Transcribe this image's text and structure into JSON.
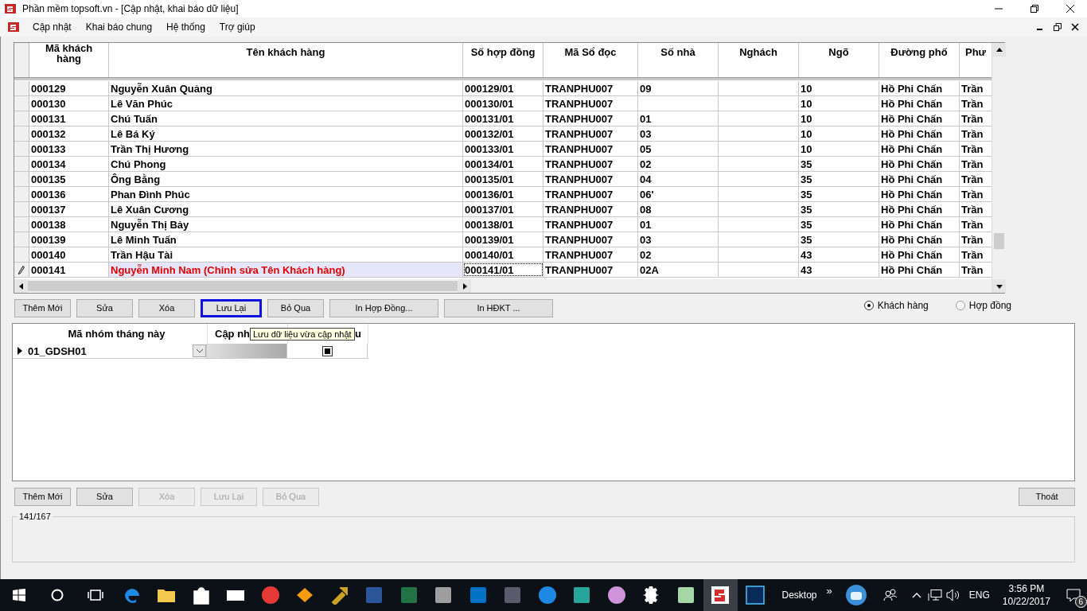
{
  "window": {
    "title": "Phần mềm topsoft.vn - [Cập nhật, khai báo dữ liệu]"
  },
  "menu": [
    {
      "label": "Cập nhật"
    },
    {
      "label": "Khai báo chung"
    },
    {
      "label": "Hệ thống"
    },
    {
      "label": "Trợ giúp"
    }
  ],
  "customer_table": {
    "columns": [
      "Mã khách hàng",
      "Tên khách hàng",
      "Số hợp đồng",
      "Mã Sổ đọc",
      "Số nhà",
      "Nghách",
      "Ngõ",
      "Đường phố",
      "Phư"
    ],
    "rows": [
      {
        "editing": false,
        "cells": [
          "000129",
          "Nguyễn Xuân Quảng",
          "000129/01",
          "TRANPHU007",
          "09",
          null,
          "10",
          "Hồ Phi Chấn",
          "Trần"
        ]
      },
      {
        "editing": false,
        "cells": [
          "000130",
          "Lê Văn Phúc",
          "000130/01",
          "TRANPHU007",
          null,
          null,
          "10",
          "Hồ Phi Chấn",
          "Trần"
        ]
      },
      {
        "editing": false,
        "cells": [
          "000131",
          "Chú Tuấn",
          "000131/01",
          "TRANPHU007",
          "01",
          null,
          "10",
          "Hồ Phi Chấn",
          "Trần"
        ]
      },
      {
        "editing": false,
        "cells": [
          "000132",
          "Lê Bá Ký",
          "000132/01",
          "TRANPHU007",
          "03",
          null,
          "10",
          "Hồ Phi Chấn",
          "Trần"
        ]
      },
      {
        "editing": false,
        "cells": [
          "000133",
          "Trần Thị Hương",
          "000133/01",
          "TRANPHU007",
          "05",
          null,
          "10",
          "Hồ Phi Chấn",
          "Trần"
        ]
      },
      {
        "editing": false,
        "cells": [
          "000134",
          "Chú Phong",
          "000134/01",
          "TRANPHU007",
          "02",
          null,
          "35",
          "Hồ Phi Chấn",
          "Trần"
        ]
      },
      {
        "editing": false,
        "cells": [
          "000135",
          "Ông Bằng",
          "000135/01",
          "TRANPHU007",
          "04",
          null,
          "35",
          "Hồ Phi Chấn",
          "Trần"
        ]
      },
      {
        "editing": false,
        "cells": [
          "000136",
          "Phan Đình Phúc",
          "000136/01",
          "TRANPHU007",
          "06'",
          null,
          "35",
          "Hồ Phi Chấn",
          "Trần"
        ]
      },
      {
        "editing": false,
        "cells": [
          "000137",
          "Lê Xuân Cương",
          "000137/01",
          "TRANPHU007",
          "08",
          null,
          "35",
          "Hồ Phi Chấn",
          "Trần"
        ]
      },
      {
        "editing": false,
        "cells": [
          "000138",
          "Nguyễn Thị Bảy",
          "000138/01",
          "TRANPHU007",
          "01",
          null,
          "35",
          "Hồ Phi Chấn",
          "Trần"
        ]
      },
      {
        "editing": false,
        "cells": [
          "000139",
          "Lê Minh Tuấn",
          "000139/01",
          "TRANPHU007",
          "03",
          null,
          "35",
          "Hồ Phi Chấn",
          "Trần"
        ]
      },
      {
        "editing": false,
        "cells": [
          "000140",
          "Trần Hậu Tài",
          "000140/01",
          "TRANPHU007",
          "02",
          null,
          "43",
          "Hồ Phi Chấn",
          "Trần"
        ]
      },
      {
        "editing": true,
        "cells": [
          "000141",
          "Nguyễn Minh Nam (Chỉnh sửa Tên Khách hàng)",
          "000141/01",
          "TRANPHU007",
          "02A",
          null,
          "43",
          "Hồ Phi Chấn",
          "Trần"
        ]
      }
    ]
  },
  "top_buttons": [
    {
      "label": "Thêm Mới",
      "disabled": false,
      "focused": false
    },
    {
      "label": "Sửa",
      "disabled": false,
      "focused": false
    },
    {
      "label": "Xóa",
      "disabled": false,
      "focused": false
    },
    {
      "label": "Lưu Lại",
      "disabled": false,
      "focused": true
    },
    {
      "label": "Bỏ Qua",
      "disabled": false,
      "focused": false
    },
    {
      "label": "In Hợp Đồng...",
      "disabled": false,
      "focused": false
    },
    {
      "label": "In HĐKT ...",
      "disabled": false,
      "focused": false
    }
  ],
  "view_options": [
    {
      "label": "Khách hàng",
      "selected": true
    },
    {
      "label": "Hợp đồng",
      "selected": false
    }
  ],
  "group_table": {
    "columns": [
      "Mã nhóm tháng này",
      "Cập nh",
      "u"
    ],
    "rows": [
      {
        "current": true,
        "ma_nhom": "01_GDSH01",
        "checked": true
      }
    ]
  },
  "tooltip": "Lưu dữ liệu vừa cập nhật",
  "bottom_buttons": [
    {
      "label": "Thêm Mới",
      "disabled": false,
      "focused": false
    },
    {
      "label": "Sửa",
      "disabled": false,
      "focused": false
    },
    {
      "label": "Xóa",
      "disabled": true,
      "focused": false
    },
    {
      "label": "Lưu Lại",
      "disabled": true,
      "focused": false
    },
    {
      "label": "Bỏ Qua",
      "disabled": true,
      "focused": false
    }
  ],
  "exit_button": {
    "label": "Thoát"
  },
  "record_group": {
    "legend": "141/167"
  },
  "taskbar": {
    "desktop_label": "Desktop",
    "chevron": "»",
    "language": "ENG",
    "time": "3:56 PM",
    "date": "10/22/2017",
    "notification_count": "6"
  }
}
